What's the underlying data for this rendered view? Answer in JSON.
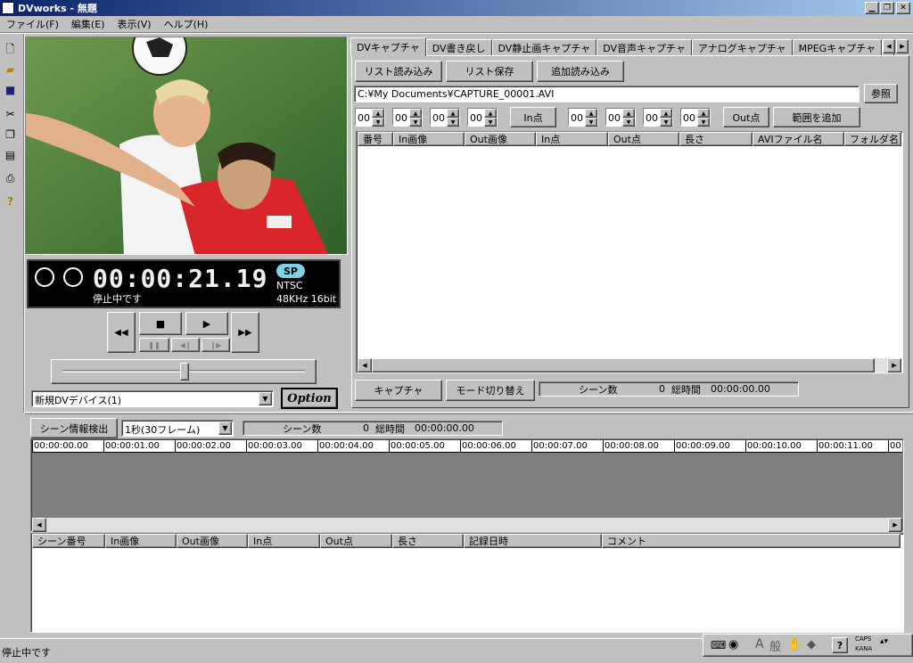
{
  "window": {
    "title": "DVworks - 無題",
    "controls": [
      "minimize",
      "restore",
      "close"
    ]
  },
  "menu": [
    "ファイル(F)",
    "編集(E)",
    "表示(V)",
    "ヘルプ(H)"
  ],
  "toolbar_icons": [
    "new-file-icon",
    "open-folder-icon",
    "save-icon",
    "cut-icon",
    "copy-icon",
    "paste-icon",
    "print-icon",
    "help-icon"
  ],
  "player": {
    "timecode": "00:00:21.19",
    "mode_badge": "SP",
    "format": "NTSC",
    "audio": "48KHz 16bit",
    "status": "停止中です",
    "device": "新規DVデバイス(1)",
    "option_label": "Option"
  },
  "tabs": [
    "DVキャプチャ",
    "DV書き戻し",
    "DV静止画キャプチャ",
    "DV音声キャプチャ",
    "アナログキャプチャ",
    "MPEGキャプチャ"
  ],
  "capture": {
    "list_load": "リスト読み込み",
    "list_save": "リスト保存",
    "add_load": "追加読み込み",
    "file_path": "C:¥My Documents¥CAPTURE_00001.AVI",
    "browse": "参照",
    "in_values": [
      "00",
      "00",
      "00",
      "00"
    ],
    "in_label": "In点",
    "out_values": [
      "00",
      "00",
      "00",
      "00"
    ],
    "out_label": "Out点",
    "add_range": "範囲を追加",
    "columns": [
      "番号",
      "In画像",
      "Out画像",
      "In点",
      "Out点",
      "長さ",
      "AVIファイル名",
      "フォルダ名"
    ],
    "capture_button": "キャプチャ",
    "mode_switch": "モード切り替え",
    "scene_count_label": "シーン数",
    "scene_count": "0",
    "total_time_label": "総時間",
    "total_time": "00:00:00.00"
  },
  "scenes": {
    "detect_button": "シーン情報検出",
    "interval": "1秒(30フレーム)",
    "scene_count_label": "シーン数",
    "scene_count": "0",
    "total_time_label": "総時間",
    "total_time": "00:00:00.00",
    "ruler": [
      "00:00:00.00",
      "00:00:01.00",
      "00:00:02.00",
      "00:00:03.00",
      "00:00:04.00",
      "00:00:05.00",
      "00:00:06.00",
      "00:00:07.00",
      "00:00:08.00",
      "00:00:09.00",
      "00:00:10.00",
      "00:00:11.00",
      "00:0"
    ],
    "columns": [
      "シーン番号",
      "In画像",
      "Out画像",
      "In点",
      "Out点",
      "長さ",
      "記録日時",
      "コメント"
    ]
  },
  "statusbar": {
    "text": "停止中です",
    "tray_letter": "A",
    "tray_kanji": "般",
    "caps": "CAPS",
    "kana": "KANA"
  },
  "colors": {
    "face": "#c0c0c0",
    "title_start": "#0a246a",
    "title_end": "#a6caf0",
    "lcd": "#000000",
    "sp_badge": "#7fd3e6"
  }
}
